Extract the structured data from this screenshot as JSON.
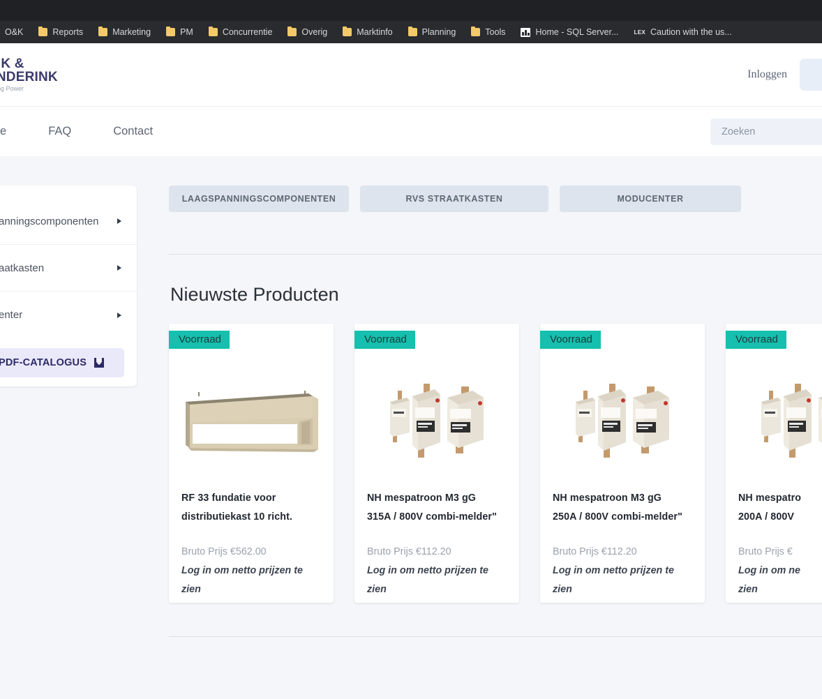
{
  "browser": {
    "bookmarks": [
      {
        "label": "O&K",
        "icon": "folder-icon"
      },
      {
        "label": "Reports",
        "icon": "folder-icon"
      },
      {
        "label": "Marketing",
        "icon": "folder-icon"
      },
      {
        "label": "PM",
        "icon": "folder-icon"
      },
      {
        "label": "Concurrentie",
        "icon": "folder-icon"
      },
      {
        "label": "Overig",
        "icon": "folder-icon"
      },
      {
        "label": "Marktinfo",
        "icon": "folder-icon"
      },
      {
        "label": "Planning",
        "icon": "folder-icon"
      },
      {
        "label": "Tools",
        "icon": "folder-icon"
      },
      {
        "label": "Home - SQL Server...",
        "icon": "sql-server-icon"
      },
      {
        "label": "Caution with the us...",
        "icon": "lex-icon"
      }
    ]
  },
  "header": {
    "logo": {
      "line1": "INK &",
      "line2": "ENDERINK",
      "tagline": "ecting Power"
    },
    "login_label": "Inloggen",
    "cart_icon": "cart-icon"
  },
  "nav": {
    "items": [
      {
        "label": "e"
      },
      {
        "label": "FAQ"
      },
      {
        "label": "Contact"
      }
    ],
    "search": {
      "placeholder": "Zoeken",
      "value": ""
    }
  },
  "sidebar": {
    "items": [
      {
        "label": "anningscomponenten",
        "caret": "caret-right-icon"
      },
      {
        "label": "aatkasten",
        "caret": "caret-right-icon"
      },
      {
        "label": "enter",
        "caret": "caret-right-icon"
      }
    ],
    "pdf_button": {
      "label": "PDF-CATALOGUS",
      "icon": "download-icon"
    }
  },
  "main": {
    "category_tabs": [
      {
        "label": "LAAGSPANNINGSCOMPONENTEN"
      },
      {
        "label": "RVS STRAATKASTEN"
      },
      {
        "label": "MODUCENTER"
      }
    ],
    "section_title": "Nieuwste Producten",
    "products": [
      {
        "badge": "Voorraad",
        "title_line1": "RF 33 fundatie voor",
        "title_line2": "distributiekast 10 richt.",
        "price_label": "Bruto Prijs €562.00",
        "login_line1": "Log in om netto prijzen te",
        "login_line2": "zien",
        "image": "foundation-box-image"
      },
      {
        "badge": "Voorraad",
        "title_line1": "NH mespatroon M3 gG",
        "title_line2": "315A / 800V combi-melder\"",
        "price_label": "Bruto Prijs €112.20",
        "login_line1": "Log in om netto prijzen te",
        "login_line2": "zien",
        "image": "nh-fuse-image"
      },
      {
        "badge": "Voorraad",
        "title_line1": "NH mespatroon M3 gG",
        "title_line2": "250A / 800V combi-melder\"",
        "price_label": "Bruto Prijs €112.20",
        "login_line1": "Log in om netto prijzen te",
        "login_line2": "zien",
        "image": "nh-fuse-image"
      },
      {
        "badge": "Voorraad",
        "title_line1": "NH mespatro",
        "title_line2": "200A / 800V",
        "price_label": "Bruto Prijs €",
        "login_line1": "Log in om ne",
        "login_line2": "zien",
        "image": "nh-fuse-image"
      }
    ]
  },
  "colors": {
    "badge_teal": "#16bfae",
    "tab_grey": "#dde4ed",
    "pdf_lavender": "#eae9fa",
    "page_bg": "#f4f6f9",
    "logo_navy": "#3a3a6b"
  }
}
